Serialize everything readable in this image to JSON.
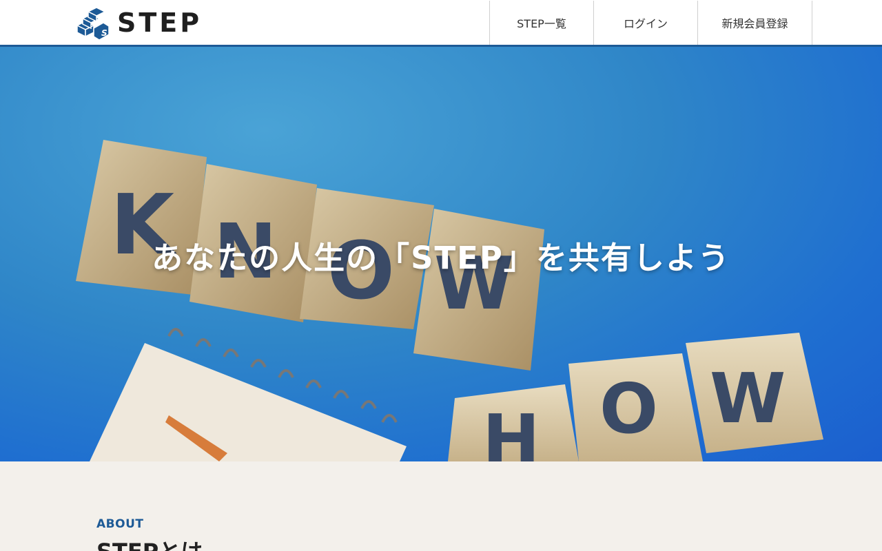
{
  "header": {
    "logo_text": "STEP",
    "brand_color": "#1d5a96",
    "nav": [
      {
        "label": "STEP一覧"
      },
      {
        "label": "ログイン"
      },
      {
        "label": "新規会員登録"
      }
    ]
  },
  "hero": {
    "title": "あなたの人生の「STEP」を共有しよう",
    "blocks_top": [
      "K",
      "N",
      "O",
      "W"
    ],
    "blocks_bottom": [
      "H",
      "O",
      "W"
    ]
  },
  "about": {
    "label": "ABOUT",
    "heading": "STEPとは"
  }
}
